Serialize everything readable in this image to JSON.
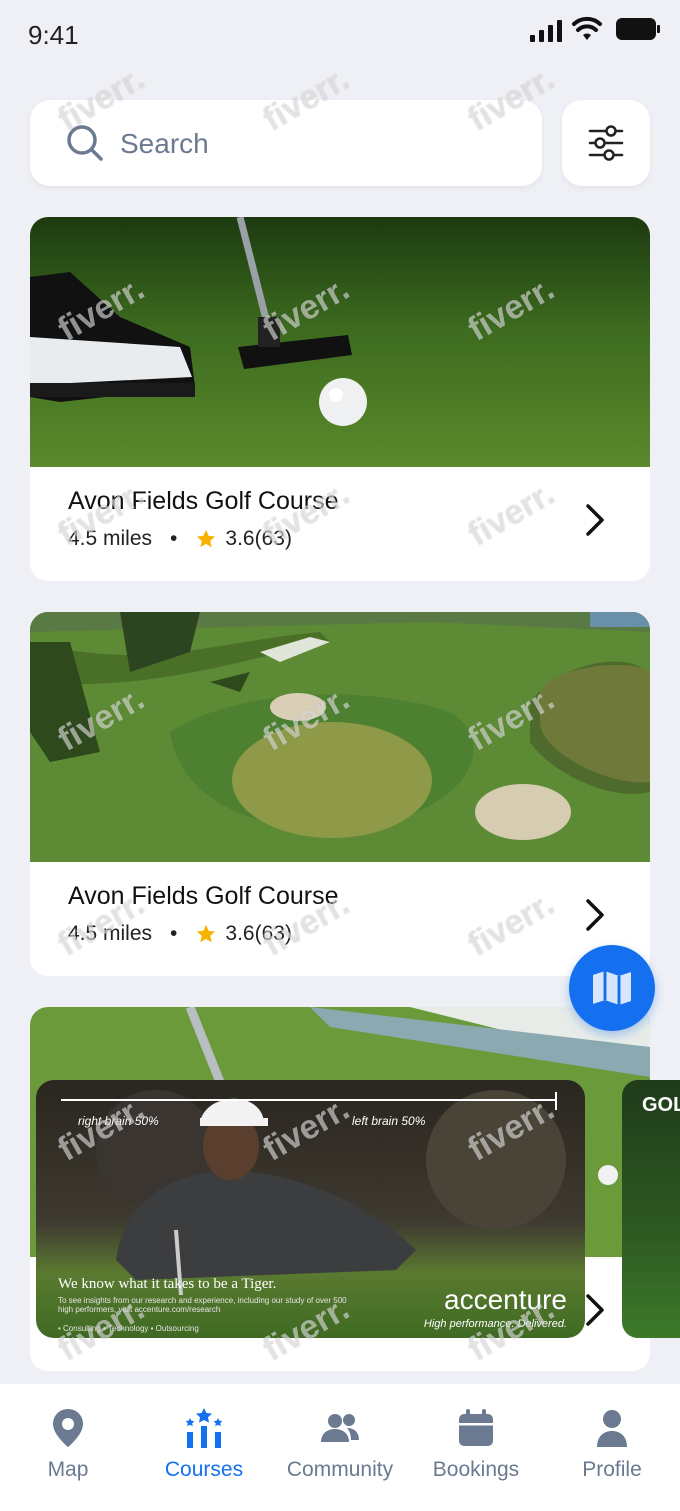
{
  "status_bar": {
    "time": "9:41"
  },
  "search": {
    "placeholder": "Search"
  },
  "courses": [
    {
      "name": "Avon Fields Golf Course",
      "distance": "4.5 miles",
      "separator": "•",
      "rating": "3.6",
      "reviews": "(63)"
    },
    {
      "name": "Avon Fields Golf Course",
      "distance": "4.5 miles",
      "separator": "•",
      "rating": "3.6",
      "reviews": "(63)"
    }
  ],
  "ad": {
    "left_label": "right brain 50%",
    "right_label": "left brain 50%",
    "headline": "We know what it takes to be a Tiger.",
    "body": "To see insights from our research and experience, including our study of over 500 high performers, visit accenture.com/research",
    "footer": "• Consulting • Technology • Outsourcing",
    "brand": "accenture",
    "tagline": "High performance. Delivered."
  },
  "ad_peek": {
    "text": "GOL"
  },
  "tabs": [
    {
      "label": "Map",
      "icon": "map-pin-icon"
    },
    {
      "label": "Courses",
      "icon": "courses-icon",
      "active": true
    },
    {
      "label": "Community",
      "icon": "community-icon"
    },
    {
      "label": "Bookings",
      "icon": "calendar-icon"
    },
    {
      "label": "Profile",
      "icon": "profile-icon"
    }
  ],
  "watermark": "fiverr.",
  "colors": {
    "accent": "#1570ef",
    "inactive": "#6b7a90",
    "star": "#f5b300",
    "background": "#eef0f5"
  }
}
